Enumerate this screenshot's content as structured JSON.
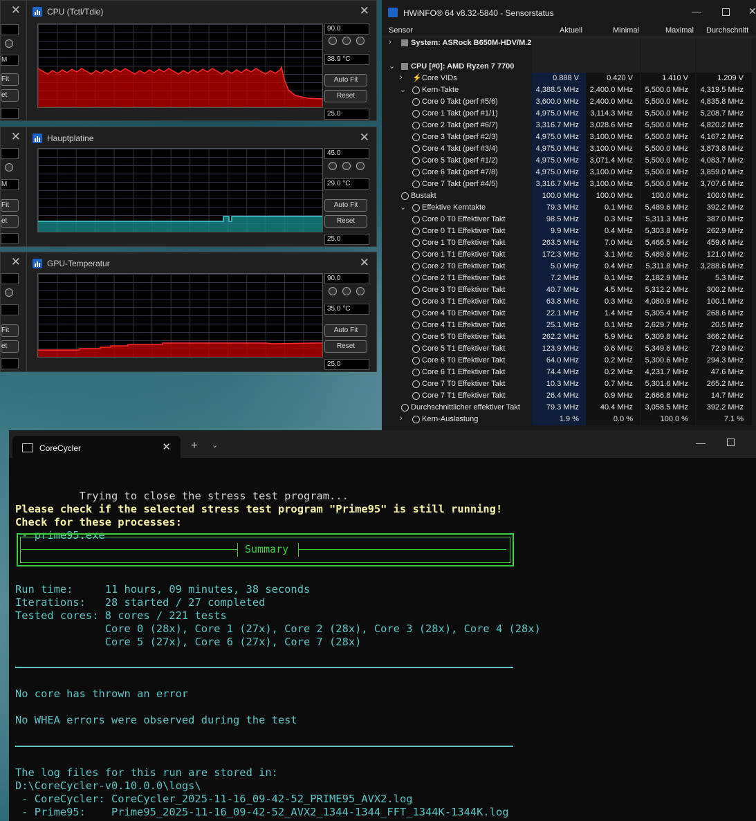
{
  "graph_windows": [
    {
      "title": "CPU (Tctl/Tdie)",
      "max": "90.0",
      "current": "38.9 °C",
      "min": "25.0",
      "autofit": "Auto Fit",
      "reset": "Reset",
      "color": "#c40000"
    },
    {
      "title": "Hauptplatine",
      "max": "45.0",
      "current": "29.0 °C",
      "min": "25.0",
      "autofit": "Auto Fit",
      "reset": "Reset",
      "color": "#1a8f8f"
    },
    {
      "title": "GPU-Temperatur",
      "max": "90.0",
      "current": "35.0 °C",
      "min": "25.0",
      "autofit": "Auto Fit",
      "reset": "Reset",
      "color": "#c40000"
    }
  ],
  "fragments": {
    "fit": "Fit",
    "et": "et",
    "m": "M"
  },
  "hwinfo": {
    "title": "HWiNFO® 64 v8.32-5840 - Sensorstatus",
    "columns": [
      "Sensor",
      "Aktuell",
      "Minimal",
      "Maximal",
      "Durchschnitt"
    ],
    "rows": [
      {
        "type": "grp",
        "label": "System: ASRock B650M-HDV/M.2",
        "vals": [
          "",
          "",
          "",
          ""
        ]
      },
      {
        "type": "blank",
        "label": "",
        "vals": [
          "",
          "",
          "",
          ""
        ]
      },
      {
        "type": "grp",
        "label": "CPU [#0]: AMD Ryzen 7 7700",
        "vals": [
          "",
          "",
          "",
          ""
        ]
      },
      {
        "type": "sub",
        "label": "Core VIDs",
        "vals": [
          "0.888 V",
          "0.420 V",
          "1.410 V",
          "1.209 V"
        ]
      },
      {
        "type": "sub",
        "label": "Kern-Takte",
        "vals": [
          "4,388.5 MHz",
          "2,400.0 MHz",
          "5,500.0 MHz",
          "4,319.5 MHz"
        ]
      },
      {
        "type": "item",
        "label": "Core 0 Takt (perf #5/6)",
        "vals": [
          "3,600.0 MHz",
          "2,400.0 MHz",
          "5,500.0 MHz",
          "4,835.8 MHz"
        ]
      },
      {
        "type": "item",
        "label": "Core 1 Takt (perf #1/1)",
        "vals": [
          "4,975.0 MHz",
          "3,114.3 MHz",
          "5,500.0 MHz",
          "5,208.7 MHz"
        ]
      },
      {
        "type": "item",
        "label": "Core 2 Takt (perf #6/7)",
        "vals": [
          "3,316.7 MHz",
          "3,028.6 MHz",
          "5,500.0 MHz",
          "4,820.2 MHz"
        ]
      },
      {
        "type": "item",
        "label": "Core 3 Takt (perf #2/3)",
        "vals": [
          "4,975.0 MHz",
          "3,100.0 MHz",
          "5,500.0 MHz",
          "4,167.2 MHz"
        ]
      },
      {
        "type": "item",
        "label": "Core 4 Takt (perf #3/4)",
        "vals": [
          "4,975.0 MHz",
          "3,100.0 MHz",
          "5,500.0 MHz",
          "3,873.8 MHz"
        ]
      },
      {
        "type": "item",
        "label": "Core 5 Takt (perf #1/2)",
        "vals": [
          "4,975.0 MHz",
          "3,071.4 MHz",
          "5,500.0 MHz",
          "4,083.7 MHz"
        ]
      },
      {
        "type": "item",
        "label": "Core 6 Takt (perf #7/8)",
        "vals": [
          "4,975.0 MHz",
          "3,100.0 MHz",
          "5,500.0 MHz",
          "3,859.0 MHz"
        ]
      },
      {
        "type": "item",
        "label": "Core 7 Takt (perf #4/5)",
        "vals": [
          "3,316.7 MHz",
          "3,100.0 MHz",
          "5,500.0 MHz",
          "3,707.6 MHz"
        ]
      },
      {
        "type": "sub1",
        "label": "Bustakt",
        "vals": [
          "100.0 MHz",
          "100.0 MHz",
          "100.0 MHz",
          "100.0 MHz"
        ]
      },
      {
        "type": "sub",
        "label": "Effektive Kerntakte",
        "vals": [
          "79.3 MHz",
          "0.1 MHz",
          "5,489.6 MHz",
          "392.2 MHz"
        ]
      },
      {
        "type": "item",
        "label": "Core 0 T0 Effektiver Takt",
        "vals": [
          "98.5 MHz",
          "0.3 MHz",
          "5,311.3 MHz",
          "387.0 MHz"
        ]
      },
      {
        "type": "item",
        "label": "Core 0 T1 Effektiver Takt",
        "vals": [
          "9.9 MHz",
          "0.4 MHz",
          "5,303.8 MHz",
          "262.9 MHz"
        ]
      },
      {
        "type": "item",
        "label": "Core 1 T0 Effektiver Takt",
        "vals": [
          "263.5 MHz",
          "7.0 MHz",
          "5,466.5 MHz",
          "459.6 MHz"
        ]
      },
      {
        "type": "item",
        "label": "Core 1 T1 Effektiver Takt",
        "vals": [
          "172.3 MHz",
          "3.1 MHz",
          "5,489.6 MHz",
          "121.0 MHz"
        ]
      },
      {
        "type": "item",
        "label": "Core 2 T0 Effektiver Takt",
        "vals": [
          "5.0 MHz",
          "0.4 MHz",
          "5,311.8 MHz",
          "3,288.6 MHz"
        ]
      },
      {
        "type": "item",
        "label": "Core 2 T1 Effektiver Takt",
        "vals": [
          "7.2 MHz",
          "0.1 MHz",
          "2,182.9 MHz",
          "5.3 MHz"
        ]
      },
      {
        "type": "item",
        "label": "Core 3 T0 Effektiver Takt",
        "vals": [
          "40.7 MHz",
          "4.5 MHz",
          "5,312.2 MHz",
          "300.2 MHz"
        ]
      },
      {
        "type": "item",
        "label": "Core 3 T1 Effektiver Takt",
        "vals": [
          "63.8 MHz",
          "0.3 MHz",
          "4,080.9 MHz",
          "100.1 MHz"
        ]
      },
      {
        "type": "item",
        "label": "Core 4 T0 Effektiver Takt",
        "vals": [
          "22.1 MHz",
          "1.4 MHz",
          "5,305.4 MHz",
          "268.6 MHz"
        ]
      },
      {
        "type": "item",
        "label": "Core 4 T1 Effektiver Takt",
        "vals": [
          "25.1 MHz",
          "0.1 MHz",
          "2,629.7 MHz",
          "20.5 MHz"
        ]
      },
      {
        "type": "item",
        "label": "Core 5 T0 Effektiver Takt",
        "vals": [
          "262.2 MHz",
          "5.9 MHz",
          "5,309.8 MHz",
          "366.2 MHz"
        ]
      },
      {
        "type": "item",
        "label": "Core 5 T1 Effektiver Takt",
        "vals": [
          "123.9 MHz",
          "0.6 MHz",
          "5,349.6 MHz",
          "72.9 MHz"
        ]
      },
      {
        "type": "item",
        "label": "Core 6 T0 Effektiver Takt",
        "vals": [
          "64.0 MHz",
          "0.2 MHz",
          "5,300.6 MHz",
          "294.3 MHz"
        ]
      },
      {
        "type": "item",
        "label": "Core 6 T1 Effektiver Takt",
        "vals": [
          "74.4 MHz",
          "0.2 MHz",
          "4,231.7 MHz",
          "47.6 MHz"
        ]
      },
      {
        "type": "item",
        "label": "Core 7 T0 Effektiver Takt",
        "vals": [
          "10.3 MHz",
          "0.7 MHz",
          "5,301.6 MHz",
          "265.2 MHz"
        ]
      },
      {
        "type": "item",
        "label": "Core 7 T1 Effektiver Takt",
        "vals": [
          "26.4 MHz",
          "0.9 MHz",
          "2,666.8 MHz",
          "14.7 MHz"
        ]
      },
      {
        "type": "sub1",
        "label": "Durchschnittlicher effektiver Takt",
        "vals": [
          "79.3 MHz",
          "40.4 MHz",
          "3,058.5 MHz",
          "392.2 MHz"
        ]
      },
      {
        "type": "sub",
        "label": "Kern-Auslastung",
        "vals": [
          "1.9 %",
          "0.0 %",
          "100.0 %",
          "7.1 %"
        ]
      }
    ]
  },
  "terminal": {
    "tab_title": "CoreCycler",
    "lines": [
      {
        "cls": "wh",
        "text": "          Trying to close the stress test program..."
      },
      {
        "cls": "y",
        "text": "Please check if the selected stress test program \"Prime95\" is still running!"
      },
      {
        "cls": "y",
        "text": "Check for these processes:"
      },
      {
        "cls": "cy",
        "text": " - prime95.exe"
      }
    ],
    "summary_label": "Summary",
    "lines2": [
      {
        "cls": "cy",
        "text": "Run time:     11 hours, 09 minutes, 38 seconds"
      },
      {
        "cls": "cy",
        "text": "Iterations:   28 started / 27 completed"
      },
      {
        "cls": "cy",
        "text": "Tested cores: 8 cores / 221 tests"
      },
      {
        "cls": "cy",
        "text": "              Core 0 (28x), Core 1 (27x), Core 2 (28x), Core 3 (28x), Core 4 (28x)"
      },
      {
        "cls": "cy",
        "text": "              Core 5 (27x), Core 6 (27x), Core 7 (28x)"
      }
    ],
    "no_error": "No core has thrown an error",
    "no_whea": "No WHEA errors were observed during the test",
    "log_lines": [
      {
        "cls": "cy",
        "text": "The log files for this run are stored in:"
      },
      {
        "cls": "cy",
        "text": "D:\\CoreCycler-v0.10.0.0\\logs\\"
      },
      {
        "cls": "cy",
        "text": " - CoreCycler: CoreCycler_2025-11-16_09-42-52_PRIME95_AVX2.log"
      },
      {
        "cls": "cy",
        "text": " - Prime95:    Prime95_2025-11-16_09-42-52_AVX2_1344-1344_FFT_1344K-1344K.log"
      }
    ]
  }
}
